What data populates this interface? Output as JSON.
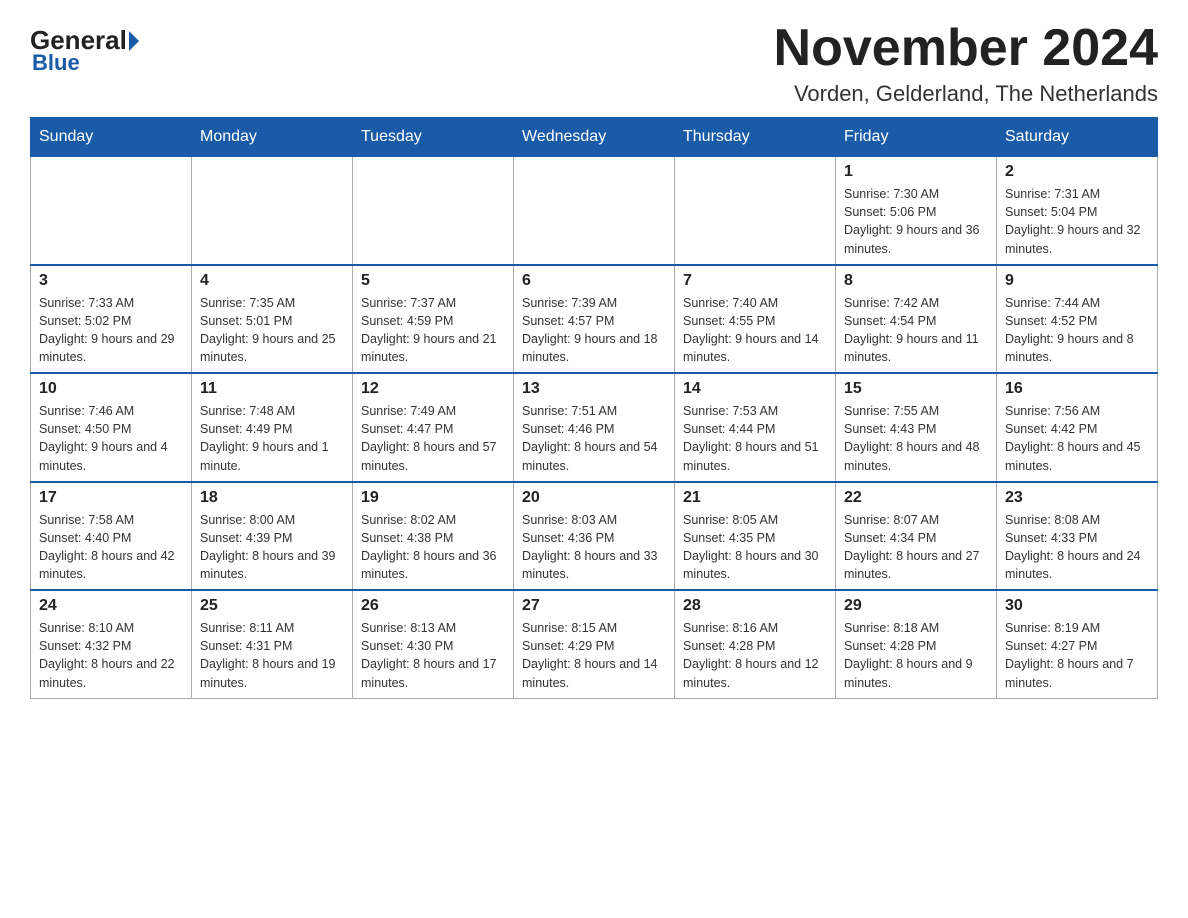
{
  "logo": {
    "general": "General",
    "blue": "Blue",
    "sub": "Blue"
  },
  "title": "November 2024",
  "location": "Vorden, Gelderland, The Netherlands",
  "days_of_week": [
    "Sunday",
    "Monday",
    "Tuesday",
    "Wednesday",
    "Thursday",
    "Friday",
    "Saturday"
  ],
  "weeks": [
    [
      {
        "day": "",
        "info": ""
      },
      {
        "day": "",
        "info": ""
      },
      {
        "day": "",
        "info": ""
      },
      {
        "day": "",
        "info": ""
      },
      {
        "day": "",
        "info": ""
      },
      {
        "day": "1",
        "info": "Sunrise: 7:30 AM\nSunset: 5:06 PM\nDaylight: 9 hours and 36 minutes."
      },
      {
        "day": "2",
        "info": "Sunrise: 7:31 AM\nSunset: 5:04 PM\nDaylight: 9 hours and 32 minutes."
      }
    ],
    [
      {
        "day": "3",
        "info": "Sunrise: 7:33 AM\nSunset: 5:02 PM\nDaylight: 9 hours and 29 minutes."
      },
      {
        "day": "4",
        "info": "Sunrise: 7:35 AM\nSunset: 5:01 PM\nDaylight: 9 hours and 25 minutes."
      },
      {
        "day": "5",
        "info": "Sunrise: 7:37 AM\nSunset: 4:59 PM\nDaylight: 9 hours and 21 minutes."
      },
      {
        "day": "6",
        "info": "Sunrise: 7:39 AM\nSunset: 4:57 PM\nDaylight: 9 hours and 18 minutes."
      },
      {
        "day": "7",
        "info": "Sunrise: 7:40 AM\nSunset: 4:55 PM\nDaylight: 9 hours and 14 minutes."
      },
      {
        "day": "8",
        "info": "Sunrise: 7:42 AM\nSunset: 4:54 PM\nDaylight: 9 hours and 11 minutes."
      },
      {
        "day": "9",
        "info": "Sunrise: 7:44 AM\nSunset: 4:52 PM\nDaylight: 9 hours and 8 minutes."
      }
    ],
    [
      {
        "day": "10",
        "info": "Sunrise: 7:46 AM\nSunset: 4:50 PM\nDaylight: 9 hours and 4 minutes."
      },
      {
        "day": "11",
        "info": "Sunrise: 7:48 AM\nSunset: 4:49 PM\nDaylight: 9 hours and 1 minute."
      },
      {
        "day": "12",
        "info": "Sunrise: 7:49 AM\nSunset: 4:47 PM\nDaylight: 8 hours and 57 minutes."
      },
      {
        "day": "13",
        "info": "Sunrise: 7:51 AM\nSunset: 4:46 PM\nDaylight: 8 hours and 54 minutes."
      },
      {
        "day": "14",
        "info": "Sunrise: 7:53 AM\nSunset: 4:44 PM\nDaylight: 8 hours and 51 minutes."
      },
      {
        "day": "15",
        "info": "Sunrise: 7:55 AM\nSunset: 4:43 PM\nDaylight: 8 hours and 48 minutes."
      },
      {
        "day": "16",
        "info": "Sunrise: 7:56 AM\nSunset: 4:42 PM\nDaylight: 8 hours and 45 minutes."
      }
    ],
    [
      {
        "day": "17",
        "info": "Sunrise: 7:58 AM\nSunset: 4:40 PM\nDaylight: 8 hours and 42 minutes."
      },
      {
        "day": "18",
        "info": "Sunrise: 8:00 AM\nSunset: 4:39 PM\nDaylight: 8 hours and 39 minutes."
      },
      {
        "day": "19",
        "info": "Sunrise: 8:02 AM\nSunset: 4:38 PM\nDaylight: 8 hours and 36 minutes."
      },
      {
        "day": "20",
        "info": "Sunrise: 8:03 AM\nSunset: 4:36 PM\nDaylight: 8 hours and 33 minutes."
      },
      {
        "day": "21",
        "info": "Sunrise: 8:05 AM\nSunset: 4:35 PM\nDaylight: 8 hours and 30 minutes."
      },
      {
        "day": "22",
        "info": "Sunrise: 8:07 AM\nSunset: 4:34 PM\nDaylight: 8 hours and 27 minutes."
      },
      {
        "day": "23",
        "info": "Sunrise: 8:08 AM\nSunset: 4:33 PM\nDaylight: 8 hours and 24 minutes."
      }
    ],
    [
      {
        "day": "24",
        "info": "Sunrise: 8:10 AM\nSunset: 4:32 PM\nDaylight: 8 hours and 22 minutes."
      },
      {
        "day": "25",
        "info": "Sunrise: 8:11 AM\nSunset: 4:31 PM\nDaylight: 8 hours and 19 minutes."
      },
      {
        "day": "26",
        "info": "Sunrise: 8:13 AM\nSunset: 4:30 PM\nDaylight: 8 hours and 17 minutes."
      },
      {
        "day": "27",
        "info": "Sunrise: 8:15 AM\nSunset: 4:29 PM\nDaylight: 8 hours and 14 minutes."
      },
      {
        "day": "28",
        "info": "Sunrise: 8:16 AM\nSunset: 4:28 PM\nDaylight: 8 hours and 12 minutes."
      },
      {
        "day": "29",
        "info": "Sunrise: 8:18 AM\nSunset: 4:28 PM\nDaylight: 8 hours and 9 minutes."
      },
      {
        "day": "30",
        "info": "Sunrise: 8:19 AM\nSunset: 4:27 PM\nDaylight: 8 hours and 7 minutes."
      }
    ]
  ]
}
